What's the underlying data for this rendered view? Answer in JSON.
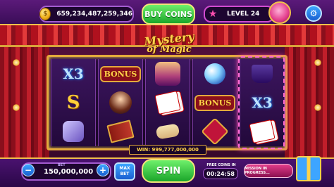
{
  "header": {
    "coins": "659,234,487,259,346",
    "coin_symbol": "$",
    "buy_label": "BUY COINS",
    "level_label": "LEVEL 24"
  },
  "logo": {
    "line1": "Mystery",
    "line2": "of Magic"
  },
  "reels": {
    "col1": [
      "X3",
      "S",
      ""
    ],
    "col2": [
      "BONUS",
      "",
      ""
    ],
    "col3": [
      "",
      "",
      ""
    ],
    "col4": [
      "",
      "BONUS",
      ""
    ],
    "col5": [
      "",
      "X3",
      ""
    ]
  },
  "win": {
    "text": "WIN: 999,777,000,000"
  },
  "footer": {
    "bet_label": "BET",
    "bet_value": "150,000,000",
    "max_bet_line1": "MAX",
    "max_bet_line2": "BET",
    "spin_label": "SPIN",
    "free_coins_label": "FREE COINS IN",
    "timer": "00:24:58",
    "mission_label": "MISSION IN PROGRESS..."
  },
  "colors": {
    "accent_gold": "#e3aa3c",
    "spin_green": "#1aa52a",
    "panel_purple": "#5b1a7a"
  }
}
